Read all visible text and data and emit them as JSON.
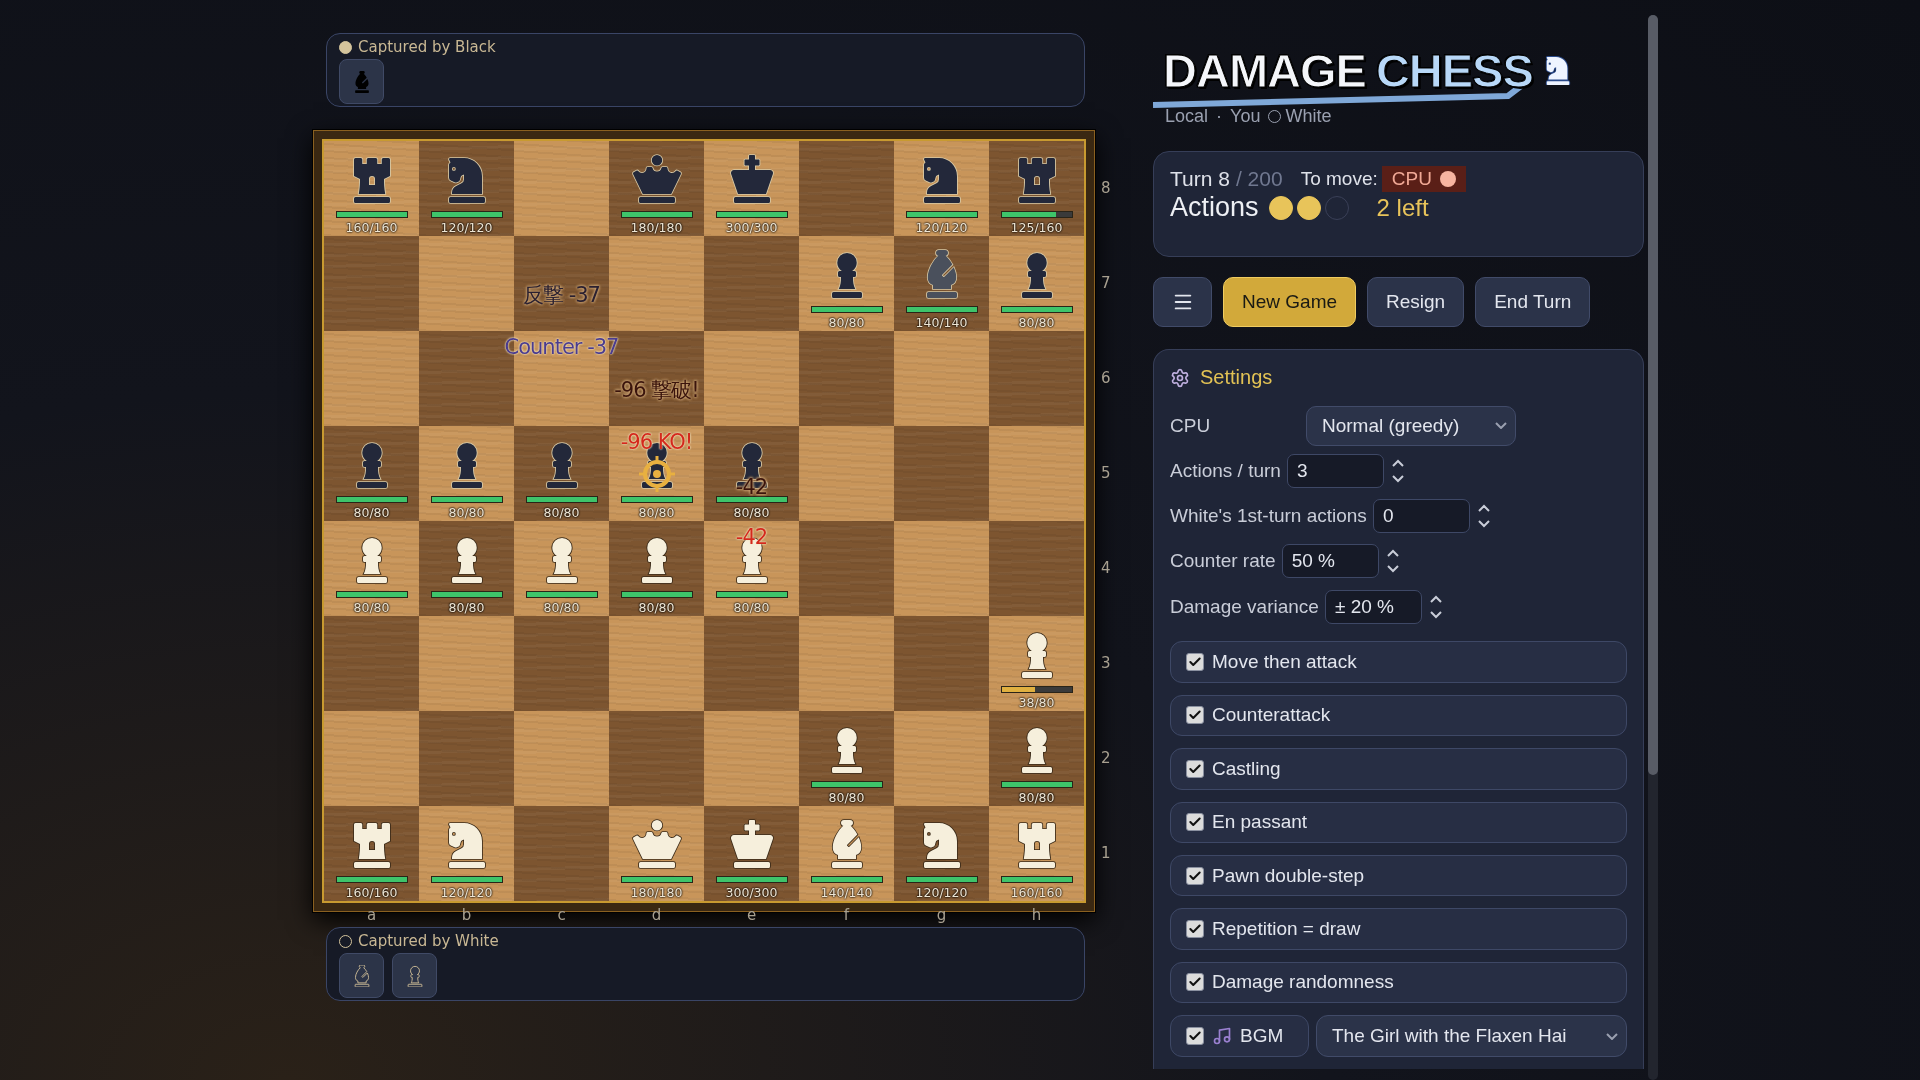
{
  "captured_top": {
    "label": "Captured by Black",
    "filled": true,
    "pieces": [
      {
        "kind": "bishop",
        "black": false
      }
    ]
  },
  "board": {
    "ranks": [
      "8",
      "7",
      "6",
      "5",
      "4",
      "3",
      "2",
      "1"
    ],
    "files": [
      "a",
      "b",
      "c",
      "d",
      "e",
      "f",
      "g",
      "h"
    ],
    "rows": [
      [
        {
          "kind": "rook",
          "black": true,
          "hp": "160/160",
          "level": 1
        },
        {
          "kind": "knight",
          "black": true,
          "hp": "120/120",
          "level": 1
        },
        {
          "kind": "empty"
        },
        {
          "kind": "queen",
          "black": true,
          "hp": "180/180",
          "level": 1
        },
        {
          "kind": "king",
          "black": true,
          "hp": "300/300",
          "level": 1
        },
        {
          "kind": "empty"
        },
        {
          "kind": "knight",
          "black": true,
          "hp": "120/120",
          "level": 1
        },
        {
          "kind": "rook",
          "black": true,
          "hp": "125/160",
          "level": 0.78
        }
      ],
      [
        {
          "kind": "empty"
        },
        {
          "kind": "empty"
        },
        {
          "kind": "empty",
          "effects": [
            {
              "text": "反撃 -37",
              "kind": "counter",
              "faded": true
            }
          ]
        },
        {
          "kind": "empty"
        },
        {
          "kind": "empty"
        },
        {
          "kind": "pawn",
          "black": true,
          "hp": "80/80",
          "level": 1
        },
        {
          "kind": "bishop",
          "black": true,
          "hp": "140/140",
          "level": 1,
          "dimmed": true
        },
        {
          "kind": "pawn",
          "black": true,
          "hp": "80/80",
          "level": 1
        }
      ],
      [
        {
          "kind": "empty"
        },
        {
          "kind": "empty"
        },
        {
          "kind": "empty",
          "effects": [
            {
              "text": "Counter -37",
              "kind": "counter",
              "faded": false
            }
          ]
        },
        {
          "kind": "empty",
          "effects": [
            {
              "text": "-96 撃破!",
              "kind": "damage",
              "faded": true
            }
          ]
        },
        {
          "kind": "empty"
        },
        {
          "kind": "empty"
        },
        {
          "kind": "empty"
        },
        {
          "kind": "empty"
        }
      ],
      [
        {
          "kind": "pawn",
          "black": true,
          "hp": "80/80",
          "level": 1
        },
        {
          "kind": "pawn",
          "black": true,
          "hp": "80/80",
          "level": 1
        },
        {
          "kind": "pawn",
          "black": true,
          "hp": "80/80",
          "level": 1
        },
        {
          "kind": "pawn",
          "black": true,
          "hp": "80/80",
          "level": 1,
          "targeted": true,
          "effects": [
            {
              "text": "-96 KO!",
              "kind": "damage",
              "faded": false
            }
          ]
        },
        {
          "kind": "pawn",
          "black": true,
          "hp": "80/80",
          "level": 1,
          "effects": [
            {
              "text": "-42",
              "kind": "damage",
              "faded": true
            }
          ]
        },
        {
          "kind": "empty"
        },
        {
          "kind": "empty"
        },
        {
          "kind": "empty"
        }
      ],
      [
        {
          "kind": "pawn",
          "black": false,
          "hp": "80/80",
          "level": 1
        },
        {
          "kind": "pawn",
          "black": false,
          "hp": "80/80",
          "level": 1
        },
        {
          "kind": "pawn",
          "black": false,
          "hp": "80/80",
          "level": 1
        },
        {
          "kind": "pawn",
          "black": false,
          "hp": "80/80",
          "level": 1
        },
        {
          "kind": "pawn",
          "black": false,
          "hp": "80/80",
          "level": 1,
          "effects": [
            {
              "text": "-42",
              "kind": "damage",
              "faded": false
            }
          ]
        },
        {
          "kind": "empty"
        },
        {
          "kind": "empty"
        },
        {
          "kind": "empty"
        }
      ],
      [
        {
          "kind": "empty"
        },
        {
          "kind": "empty"
        },
        {
          "kind": "empty"
        },
        {
          "kind": "empty"
        },
        {
          "kind": "empty"
        },
        {
          "kind": "empty"
        },
        {
          "kind": "empty"
        },
        {
          "kind": "pawn",
          "black": false,
          "hp": "38/80",
          "level": 0.475
        }
      ],
      [
        {
          "kind": "empty"
        },
        {
          "kind": "empty"
        },
        {
          "kind": "empty"
        },
        {
          "kind": "empty"
        },
        {
          "kind": "empty"
        },
        {
          "kind": "pawn",
          "black": false,
          "hp": "80/80",
          "level": 1
        },
        {
          "kind": "empty"
        },
        {
          "kind": "pawn",
          "black": false,
          "hp": "80/80",
          "level": 1
        }
      ],
      [
        {
          "kind": "rook",
          "black": false,
          "hp": "160/160",
          "level": 1
        },
        {
          "kind": "knight",
          "black": false,
          "hp": "120/120",
          "level": 1
        },
        {
          "kind": "empty"
        },
        {
          "kind": "queen",
          "black": false,
          "hp": "180/180",
          "level": 1
        },
        {
          "kind": "king",
          "black": false,
          "hp": "300/300",
          "level": 1
        },
        {
          "kind": "bishop",
          "black": false,
          "hp": "140/140",
          "level": 1
        },
        {
          "kind": "knight",
          "black": false,
          "hp": "120/120",
          "level": 1
        },
        {
          "kind": "rook",
          "black": false,
          "hp": "160/160",
          "level": 1
        }
      ]
    ]
  },
  "captured_bottom": {
    "label": "Captured by White",
    "filled": false,
    "pieces": [
      {
        "kind": "bishop",
        "black": true
      },
      {
        "kind": "pawn",
        "black": true
      }
    ]
  },
  "logo": {
    "word_1": "DAMAGE",
    "word_2": "CHESS"
  },
  "subtitle": {
    "mode": "Local",
    "separator": "·",
    "player": "You",
    "side": "White"
  },
  "status": {
    "turn": "Turn 8",
    "turn_limit": "/ 200",
    "to_move_label": "To move:",
    "to_move": "CPU",
    "actions_label": "Actions",
    "pips": [
      {
        "filled": true
      },
      {
        "filled": true
      },
      {
        "filled": false
      }
    ],
    "actions_left": "2 left"
  },
  "toolbar": [
    {
      "kind": "menu"
    },
    {
      "kind": "button",
      "label": "New Game",
      "primary": true
    },
    {
      "kind": "button",
      "label": "Resign",
      "primary": false
    },
    {
      "kind": "button",
      "label": "End Turn",
      "primary": false
    }
  ],
  "settings": {
    "title": "Settings",
    "fields": [
      {
        "kind": "select",
        "label": "CPU",
        "value": "Normal (greedy)"
      },
      {
        "kind": "number",
        "label": "Actions / turn",
        "value": "3"
      },
      {
        "kind": "number",
        "label": "White's 1st-turn actions",
        "value": "0"
      },
      {
        "kind": "number",
        "label": "Counter rate",
        "value": "50 %"
      },
      {
        "kind": "number",
        "label": "Damage variance",
        "value": "± 20 %"
      }
    ],
    "toggles": [
      {
        "label": "Move then attack",
        "checked": true
      },
      {
        "label": "Counterattack",
        "checked": true
      },
      {
        "label": "Castling",
        "checked": true
      },
      {
        "label": "En passant",
        "checked": true
      },
      {
        "label": "Pawn double-step",
        "checked": true
      },
      {
        "label": "Repetition = draw",
        "checked": true
      },
      {
        "label": "Damage randomness",
        "checked": true
      }
    ],
    "bgm": {
      "label": "BGM",
      "checked": true,
      "track": "The Girl with the Flaxen Hai"
    }
  }
}
